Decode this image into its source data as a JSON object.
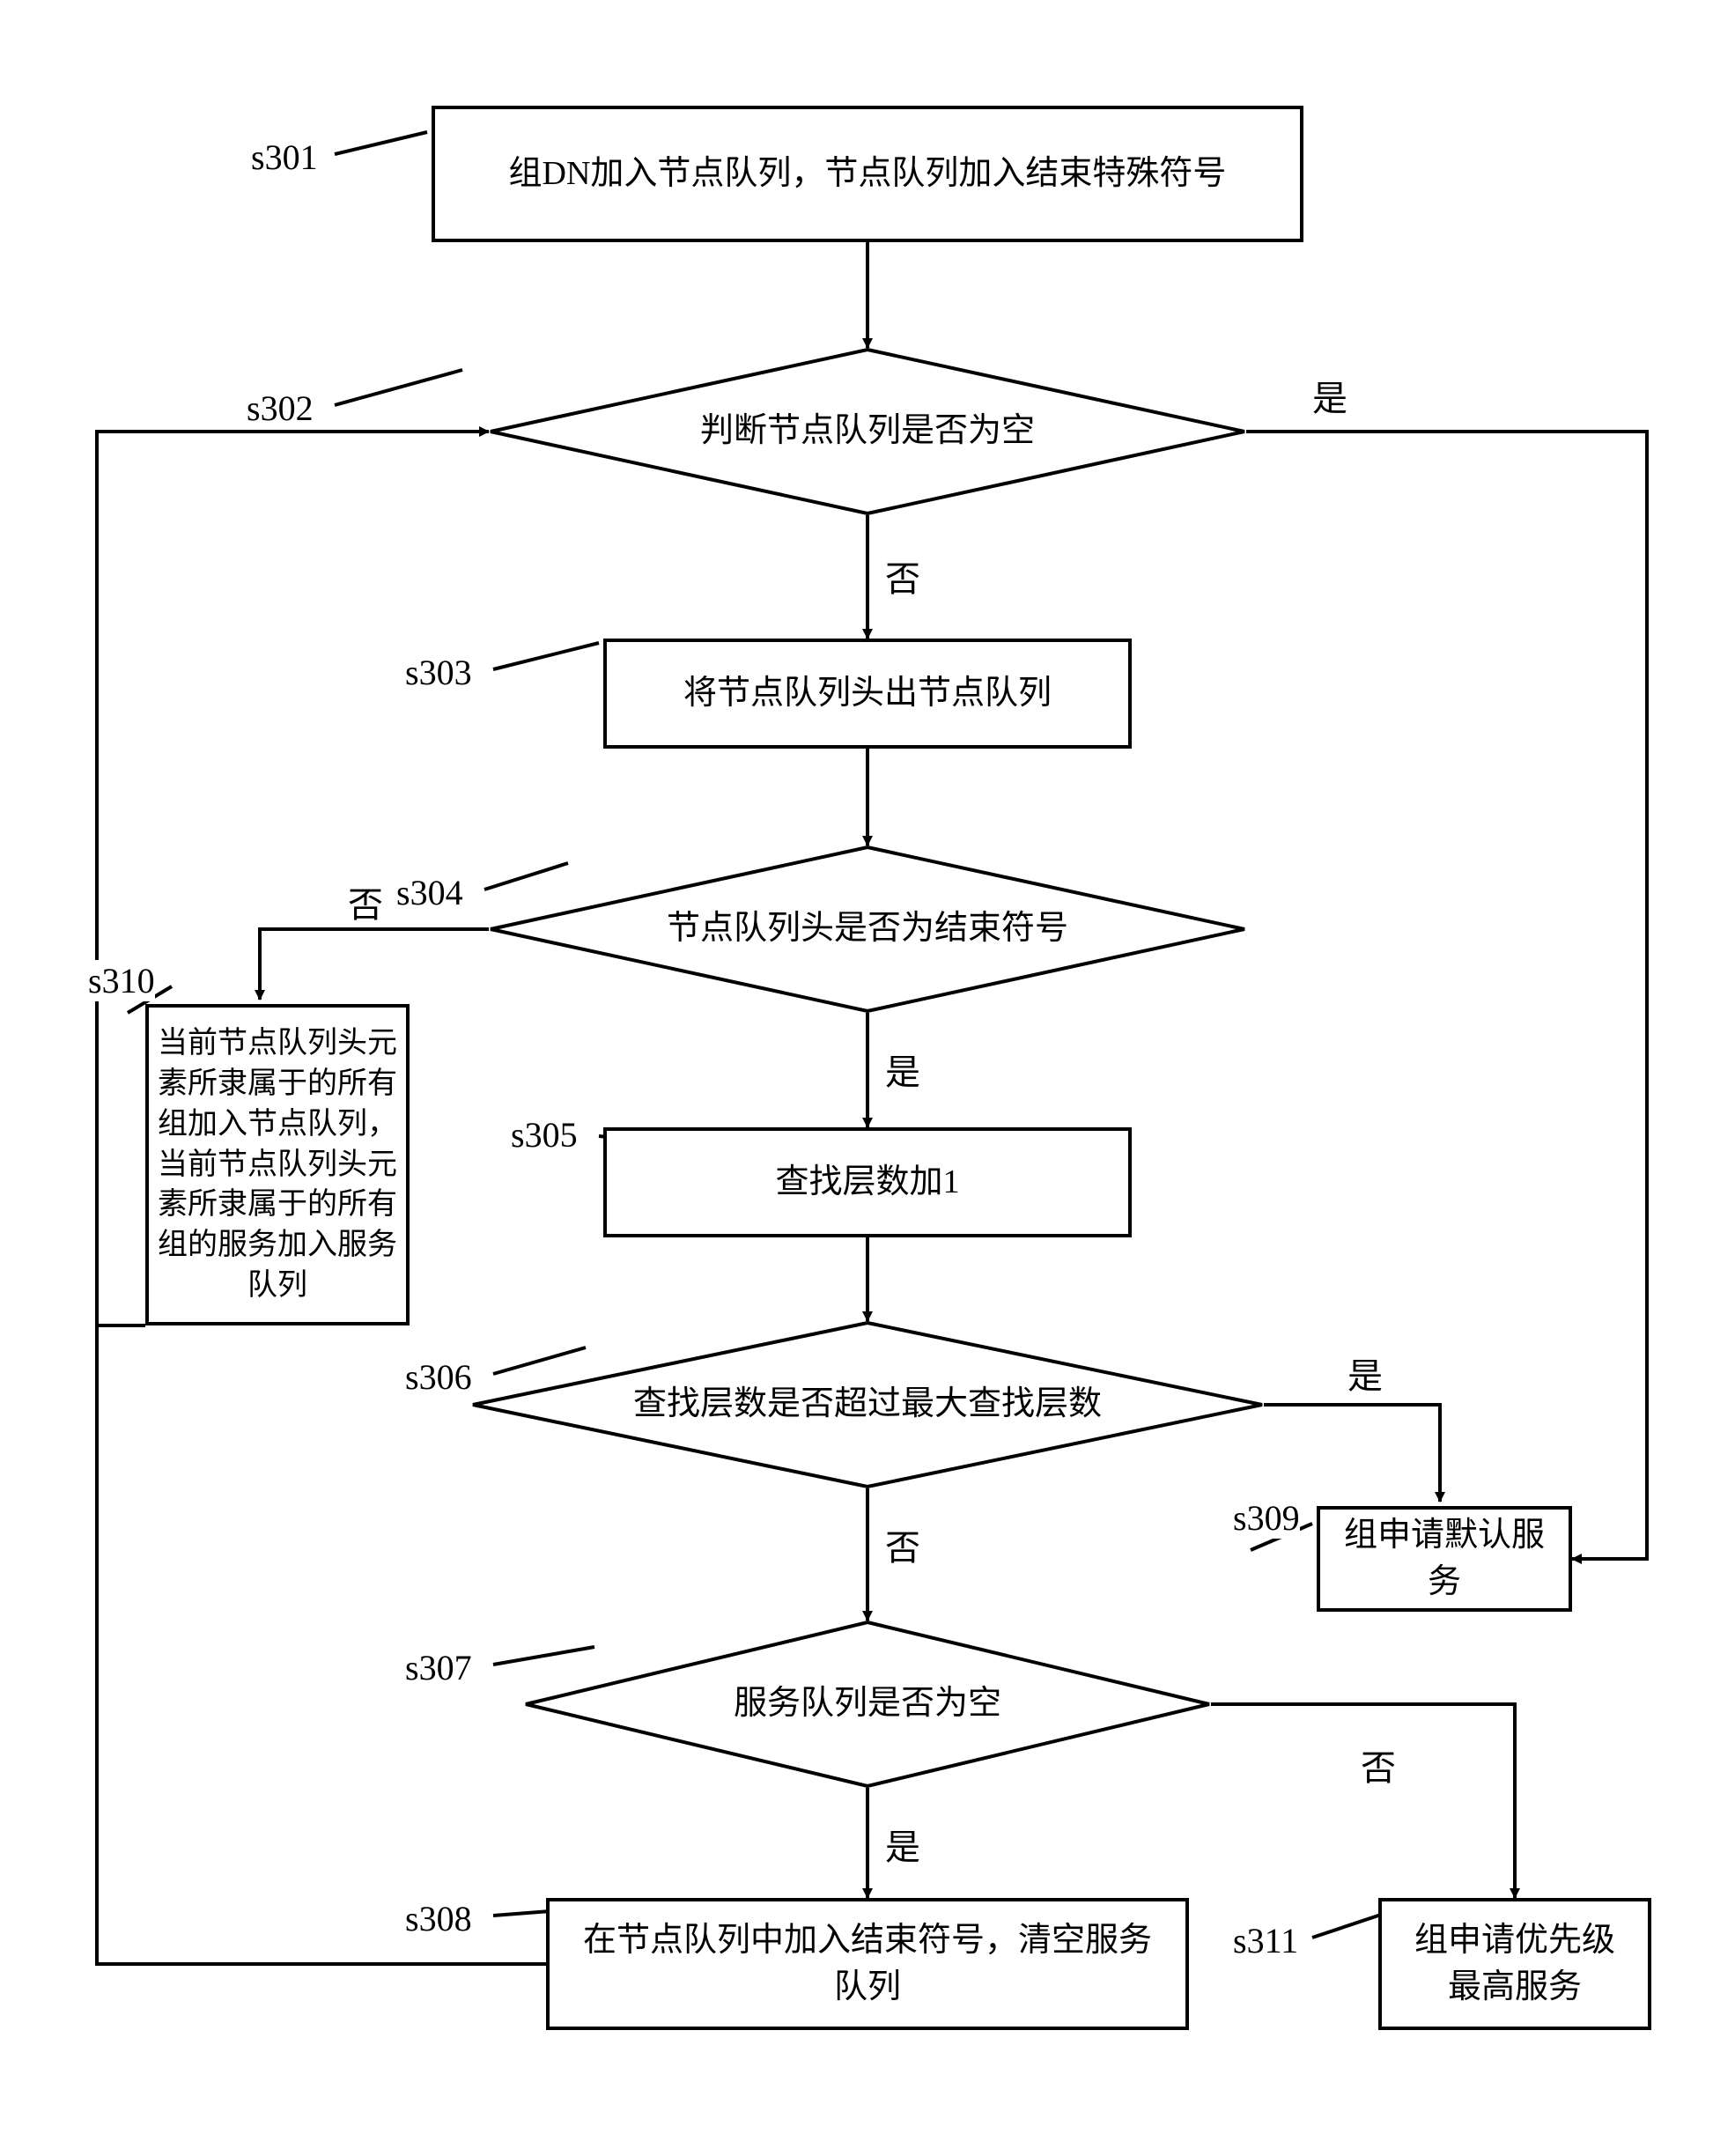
{
  "chart_data": {
    "type": "flowchart",
    "nodes": [
      {
        "id": "s301",
        "label": "s301",
        "type": "process",
        "text": "组DN加入节点队列，节点队列加入结束特殊符号"
      },
      {
        "id": "s302",
        "label": "s302",
        "type": "decision",
        "text": "判断节点队列是否为空",
        "yes": "s309",
        "no": "s303"
      },
      {
        "id": "s303",
        "label": "s303",
        "type": "process",
        "text": "将节点队列头出节点队列"
      },
      {
        "id": "s304",
        "label": "s304",
        "type": "decision",
        "text": "节点队列头是否为结束符号",
        "yes": "s305",
        "no": "s310"
      },
      {
        "id": "s305",
        "label": "s305",
        "type": "process",
        "text": "查找层数加1"
      },
      {
        "id": "s306",
        "label": "s306",
        "type": "decision",
        "text": "查找层数是否超过最大查找层数",
        "yes": "s309",
        "no": "s307"
      },
      {
        "id": "s307",
        "label": "s307",
        "type": "decision",
        "text": "服务队列是否为空",
        "yes": "s308",
        "no": "s311"
      },
      {
        "id": "s308",
        "label": "s308",
        "type": "process",
        "text": "在节点队列中加入结束符号，清空服务队列"
      },
      {
        "id": "s309",
        "label": "s309",
        "type": "process",
        "text": "组申请默认服务"
      },
      {
        "id": "s310",
        "label": "s310",
        "type": "process",
        "text": "当前节点队列头元素所隶属于的所有组加入节点队列，当前节点队列头元素所隶属于的所有组的服务加入服务队列"
      },
      {
        "id": "s311",
        "label": "s311",
        "type": "process",
        "text": "组申请优先级最高服务"
      }
    ],
    "edges": [
      {
        "from": "s301",
        "to": "s302"
      },
      {
        "from": "s302",
        "to": "s303",
        "label": "否"
      },
      {
        "from": "s302",
        "to": "s309",
        "label": "是"
      },
      {
        "from": "s303",
        "to": "s304"
      },
      {
        "from": "s304",
        "to": "s305",
        "label": "是"
      },
      {
        "from": "s304",
        "to": "s310",
        "label": "否"
      },
      {
        "from": "s305",
        "to": "s306"
      },
      {
        "from": "s306",
        "to": "s307",
        "label": "否"
      },
      {
        "from": "s306",
        "to": "s309",
        "label": "是"
      },
      {
        "from": "s307",
        "to": "s308",
        "label": "是"
      },
      {
        "from": "s307",
        "to": "s311",
        "label": "否"
      },
      {
        "from": "s310",
        "to": "s302"
      },
      {
        "from": "s308",
        "to": "s302"
      }
    ],
    "branch_labels": {
      "yes": "是",
      "no": "否"
    }
  },
  "labels": {
    "s301": "s301",
    "s302": "s302",
    "s303": "s303",
    "s304": "s304",
    "s305": "s305",
    "s306": "s306",
    "s307": "s307",
    "s308": "s308",
    "s309": "s309",
    "s310": "s310",
    "s311": "s311"
  },
  "text": {
    "s301": "组DN加入节点队列，节点队列加入结束特殊符号",
    "s302": "判断节点队列是否为空",
    "s303": "将节点队列头出节点队列",
    "s304": "节点队列头是否为结束符号",
    "s305": "查找层数加1",
    "s306": "查找层数是否超过最大查找层数",
    "s307": "服务队列是否为空",
    "s308": "在节点队列中加入结束符号，清空服务队列",
    "s309": "组申请默认服务",
    "s310": "当前节点队列头元素所隶属于的所有组加入节点队列，当前节点队列头元素所隶属于的所有组的服务加入服务队列",
    "s311": "组申请优先级最高服务",
    "yes": "是",
    "no": "否"
  }
}
